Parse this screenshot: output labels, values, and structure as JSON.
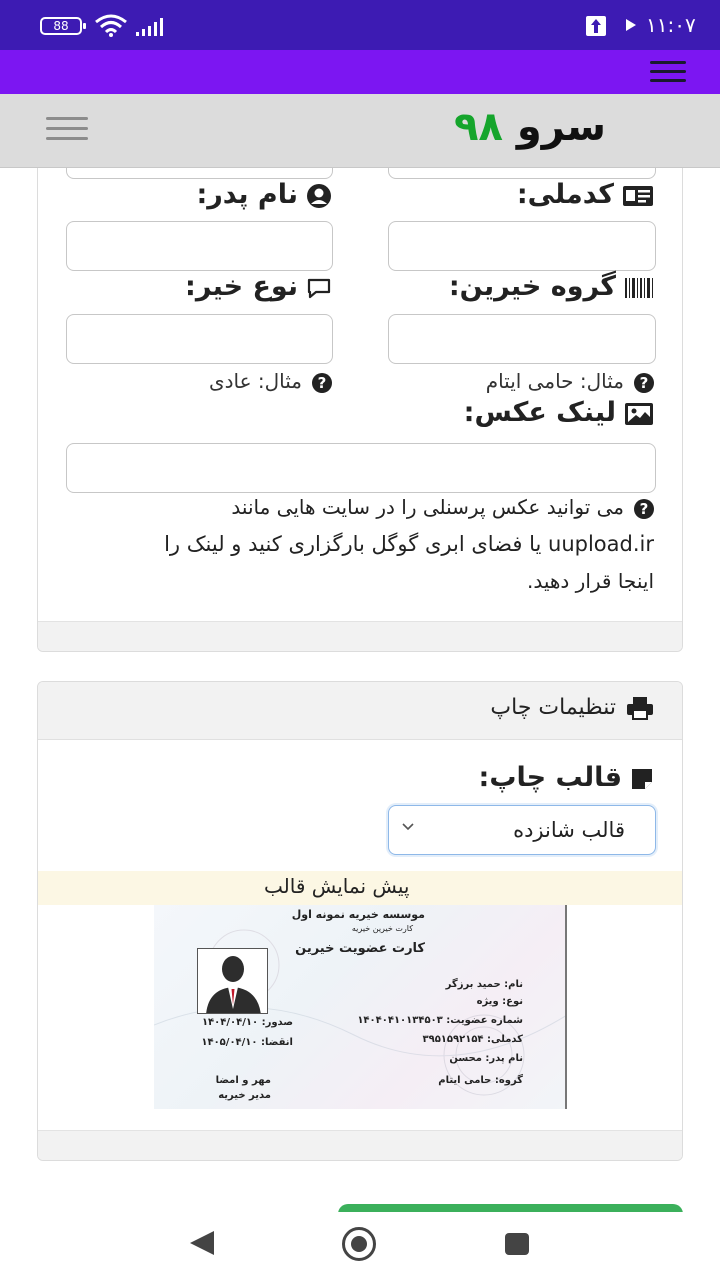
{
  "status_bar": {
    "battery": "88",
    "time": "۱۱:۰۷"
  },
  "navbar": {
    "brand_word": "سرو",
    "brand_number": "۹۸"
  },
  "form": {
    "father_name_label": "نام پدر:",
    "national_code_label": "کدملی:",
    "charity_type_label": "نوع خیر:",
    "donor_group_label": "گروه خیرین:",
    "charity_type_hint": "مثال: عادی",
    "donor_group_hint": "مثال: حامی ایتام",
    "photo_link_label": "لینک عکس:",
    "photo_help_line1": "می توانید عکس پرسنلی را در سایت هایی مانند",
    "photo_help_line2": "uupload.ir یا فضای ابری گوگل بارگزاری کنید و لینک را",
    "photo_help_line3": "اینجا قرار دهید."
  },
  "print_settings": {
    "title": "تنظیمات چاپ",
    "template_label": "قالب چاپ:",
    "template_selected": "قالب شانزده",
    "preview_title": "پیش نمایش قالب"
  },
  "id_card": {
    "org_name": "موسسه خیریه نمونه اول",
    "org_sub": "کارت خیرین خیریه",
    "card_title": "کارت عضویت خیرین",
    "name_line": "نام: حمید برزگر",
    "type_line": "نوع: ویژه",
    "member_no_line": "شماره عضویت: ۱۴۰۴۰۴۱۰۱۳۴۵۰۳",
    "national_code_line": "کدملی: ۳۹۵۱۵۹۲۱۵۴",
    "father_line": "نام پدر: محسن",
    "group_line": "گروه: حامی ایتام",
    "issue_label": "صدور:",
    "issue_date": "۱۴۰۴/۰۴/۱۰",
    "expire_label": "انقضا:",
    "expire_date": "۱۴۰۵/۰۴/۱۰",
    "stamp_line1": "مهر و امضا",
    "stamp_line2": "مدیر خیریه"
  },
  "colors": {
    "status_bar": "#3d1bb3",
    "header_bar": "#7c16f2",
    "brand_number": "#15a52c",
    "submit_button": "#3bb05b"
  }
}
